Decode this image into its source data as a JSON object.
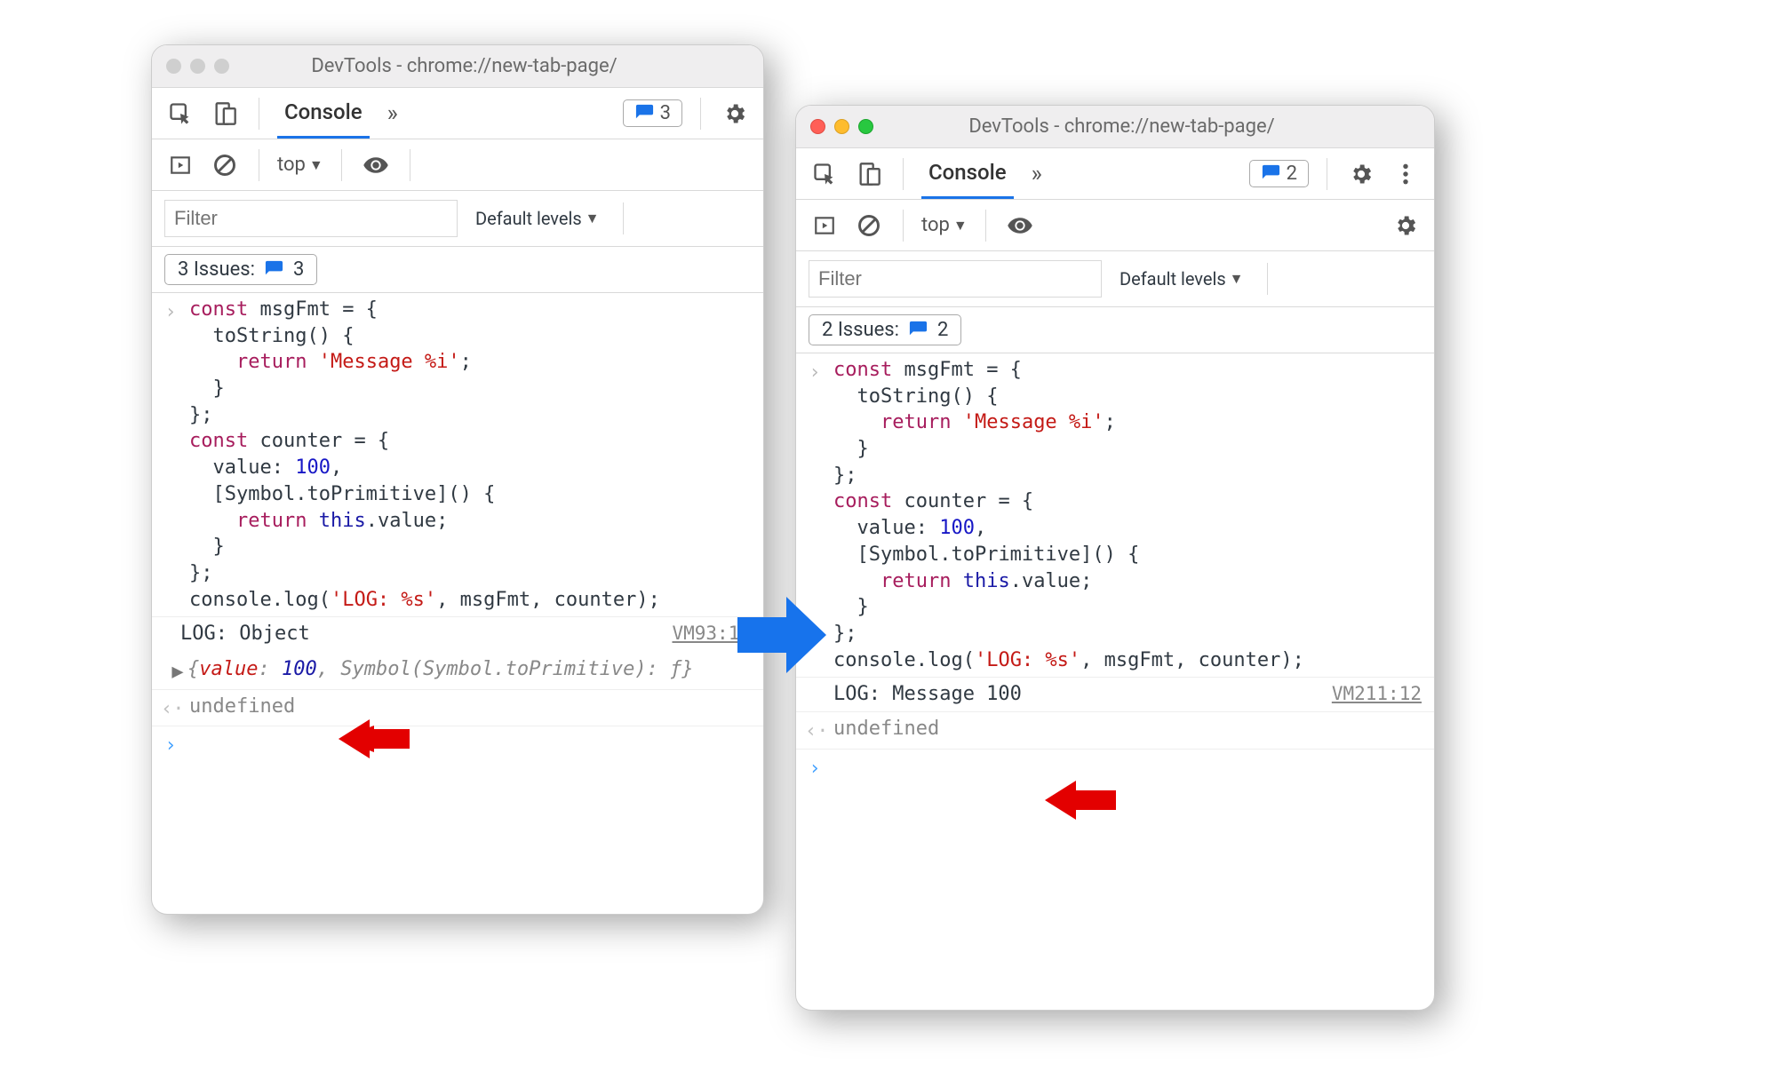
{
  "windows": {
    "left": {
      "title": "DevTools - chrome://new-tab-page/",
      "traffic_style": "inactive",
      "toolbar": {
        "active_tab": "Console",
        "issue_count": "3"
      },
      "context_row": {
        "context": "top",
        "filter_placeholder": "Filter",
        "levels": "Default levels"
      },
      "issues_bar": {
        "label": "3 Issues:",
        "count": "3"
      },
      "console": {
        "input_code": {
          "l1": "const",
          "l1b": " msgFmt = {",
          "l2": "  toString() {",
          "l3a": "    ",
          "l3b": "return",
          "l3c": " ",
          "l3d": "'Message %i'",
          "l3e": ";",
          "l4": "  }",
          "l5": "};",
          "l6": "const",
          "l6b": " counter = {",
          "l7a": "  value: ",
          "l7b": "100",
          "l7c": ",",
          "l8": "  [Symbol.toPrimitive]() {",
          "l9a": "    ",
          "l9b": "return",
          "l9c": " ",
          "l9d": "this",
          "l9e": ".value;",
          "l10": "  }",
          "l11": "};",
          "l12a": "console.log(",
          "l12b": "'LOG: %s'",
          "l12c": ", msgFmt, counter);"
        },
        "output": {
          "text": "LOG: Object",
          "src": "VM93:12",
          "expanded": "{value: 100, Symbol(Symbol.toPrimitive): ƒ}",
          "expanded_k1": "value",
          "expanded_v1": "100",
          "expanded_rest": ", Symbol(Symbol.toPrimitive): ƒ}"
        },
        "ret": "undefined"
      }
    },
    "right": {
      "title": "DevTools - chrome://new-tab-page/",
      "traffic_style": "active",
      "toolbar": {
        "active_tab": "Console",
        "issue_count": "2"
      },
      "context_row": {
        "context": "top",
        "filter_placeholder": "Filter",
        "levels": "Default levels"
      },
      "issues_bar": {
        "label": "2 Issues:",
        "count": "2"
      },
      "console": {
        "input_code": {
          "l1": "const",
          "l1b": " msgFmt = {",
          "l2": "  toString() {",
          "l3a": "    ",
          "l3b": "return",
          "l3c": " ",
          "l3d": "'Message %i'",
          "l3e": ";",
          "l4": "  }",
          "l5": "};",
          "l6": "const",
          "l6b": " counter = {",
          "l7a": "  value: ",
          "l7b": "100",
          "l7c": ",",
          "l8": "  [Symbol.toPrimitive]() {",
          "l9a": "    ",
          "l9b": "return",
          "l9c": " ",
          "l9d": "this",
          "l9e": ".value;",
          "l10": "  }",
          "l11": "};",
          "l12a": "console.log(",
          "l12b": "'LOG: %s'",
          "l12c": ", msgFmt, counter);"
        },
        "output": {
          "text": "LOG: Message 100",
          "src": "VM211:12"
        },
        "ret": "undefined"
      }
    }
  }
}
